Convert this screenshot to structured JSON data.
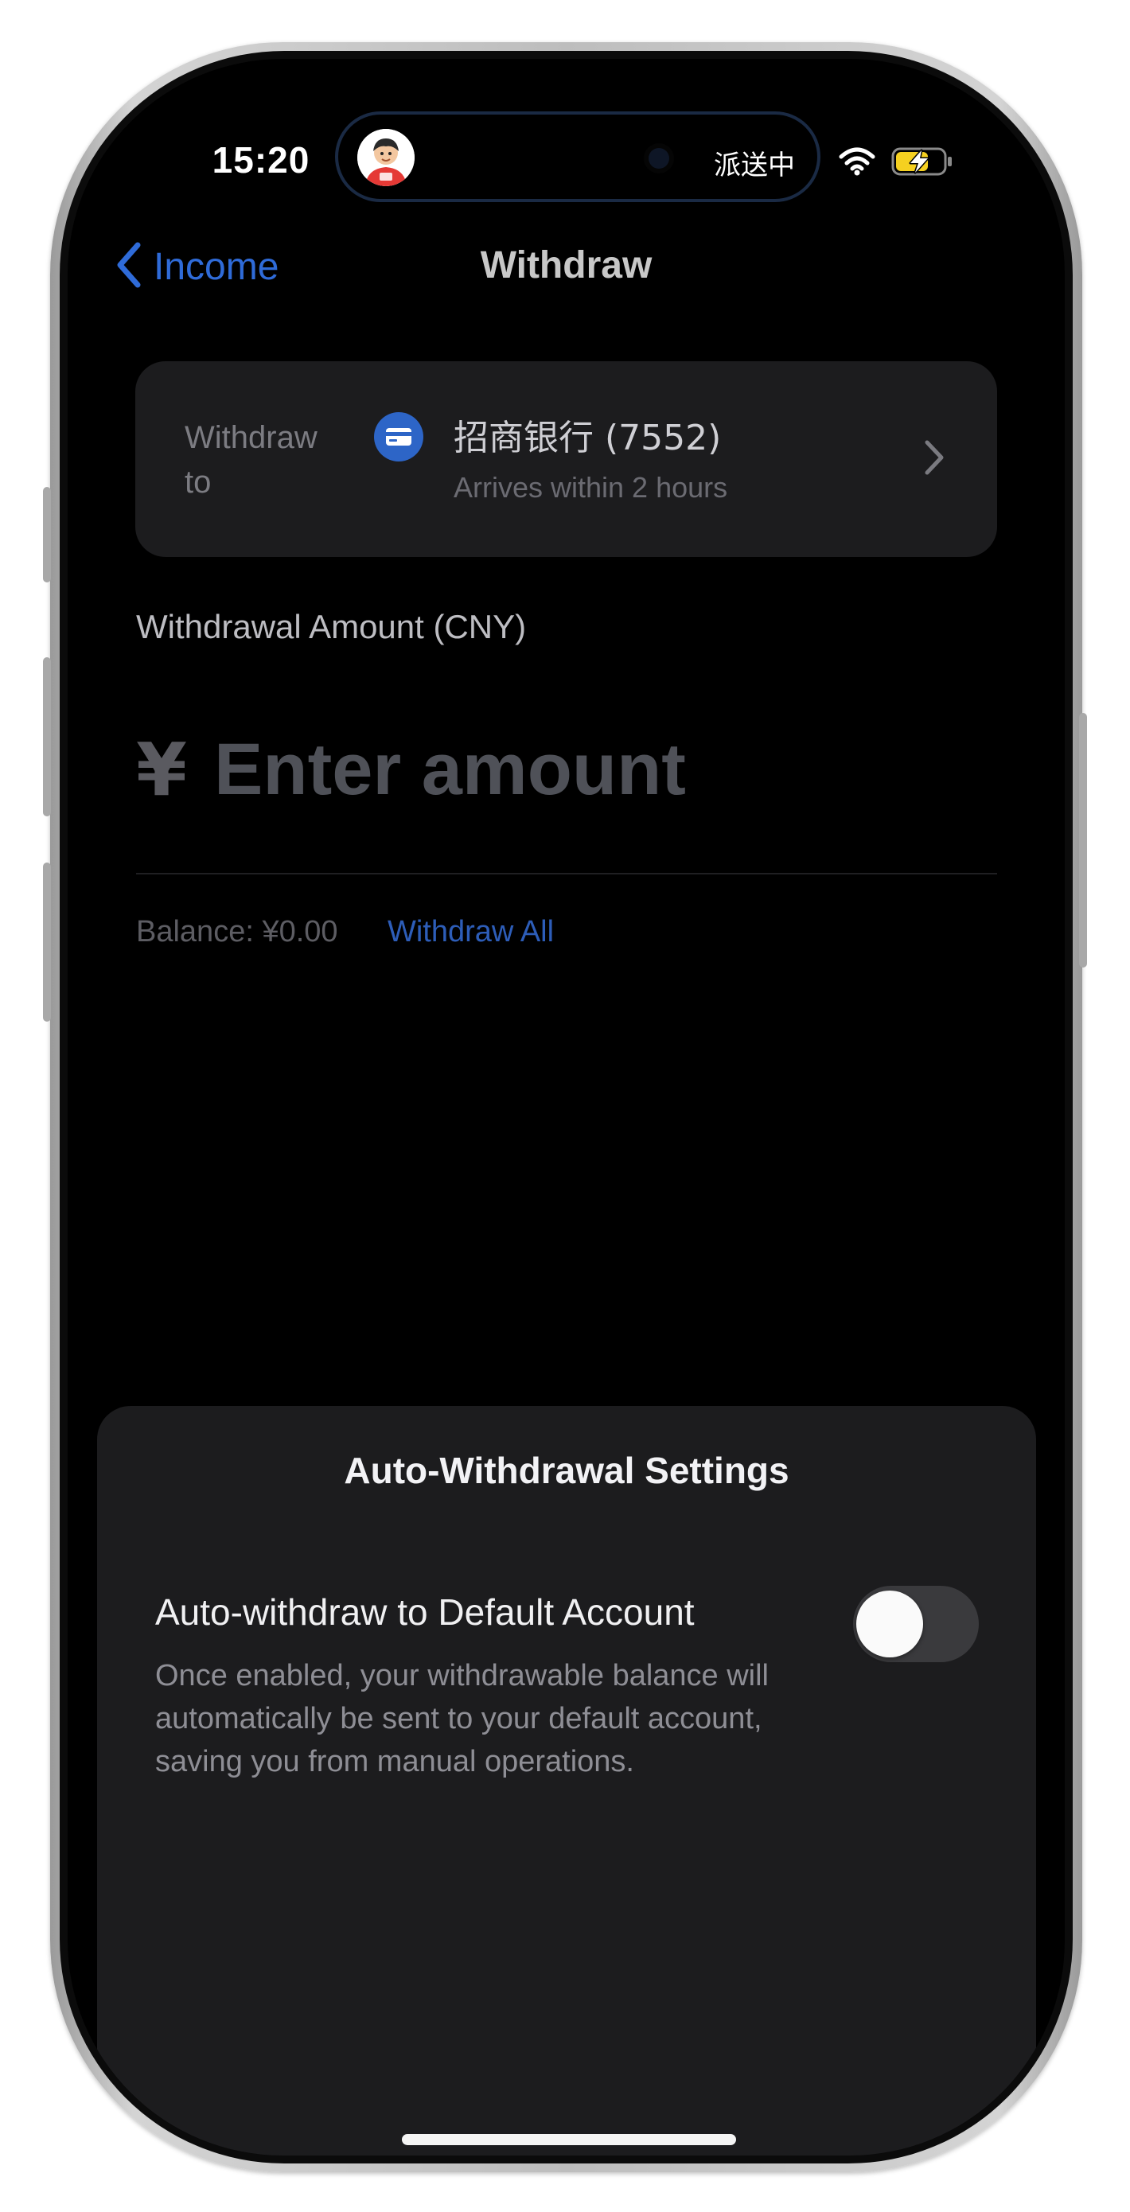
{
  "status_bar": {
    "time": "15:20",
    "live_activity_text": "派送中",
    "icons": [
      "wifi-icon",
      "battery-charging-icon"
    ]
  },
  "nav": {
    "back_label": "Income",
    "title": "Withdraw"
  },
  "withdraw_to": {
    "label": "Withdraw to",
    "bank_name": "招商银行 (7552)",
    "arrival_note": "Arrives within 2 hours"
  },
  "amount": {
    "label": "Withdrawal Amount (CNY)",
    "currency_symbol": "¥",
    "value": "",
    "placeholder": "Enter amount"
  },
  "balance": {
    "text": "Balance: ¥0.00",
    "withdraw_all_label": "Withdraw All"
  },
  "sheet": {
    "title": "Auto-Withdrawal Settings",
    "option_title": "Auto-withdraw to Default Account",
    "option_description": "Once enabled, your withdrawable balance will automatically be sent to your default account, saving you from manual operations.",
    "toggle_on": false
  },
  "colors": {
    "accent": "#2f6bd8",
    "background": "#000000",
    "card": "#1c1c1e",
    "bank_icon": "#2d65c7",
    "battery_charge": "#f5d020"
  }
}
